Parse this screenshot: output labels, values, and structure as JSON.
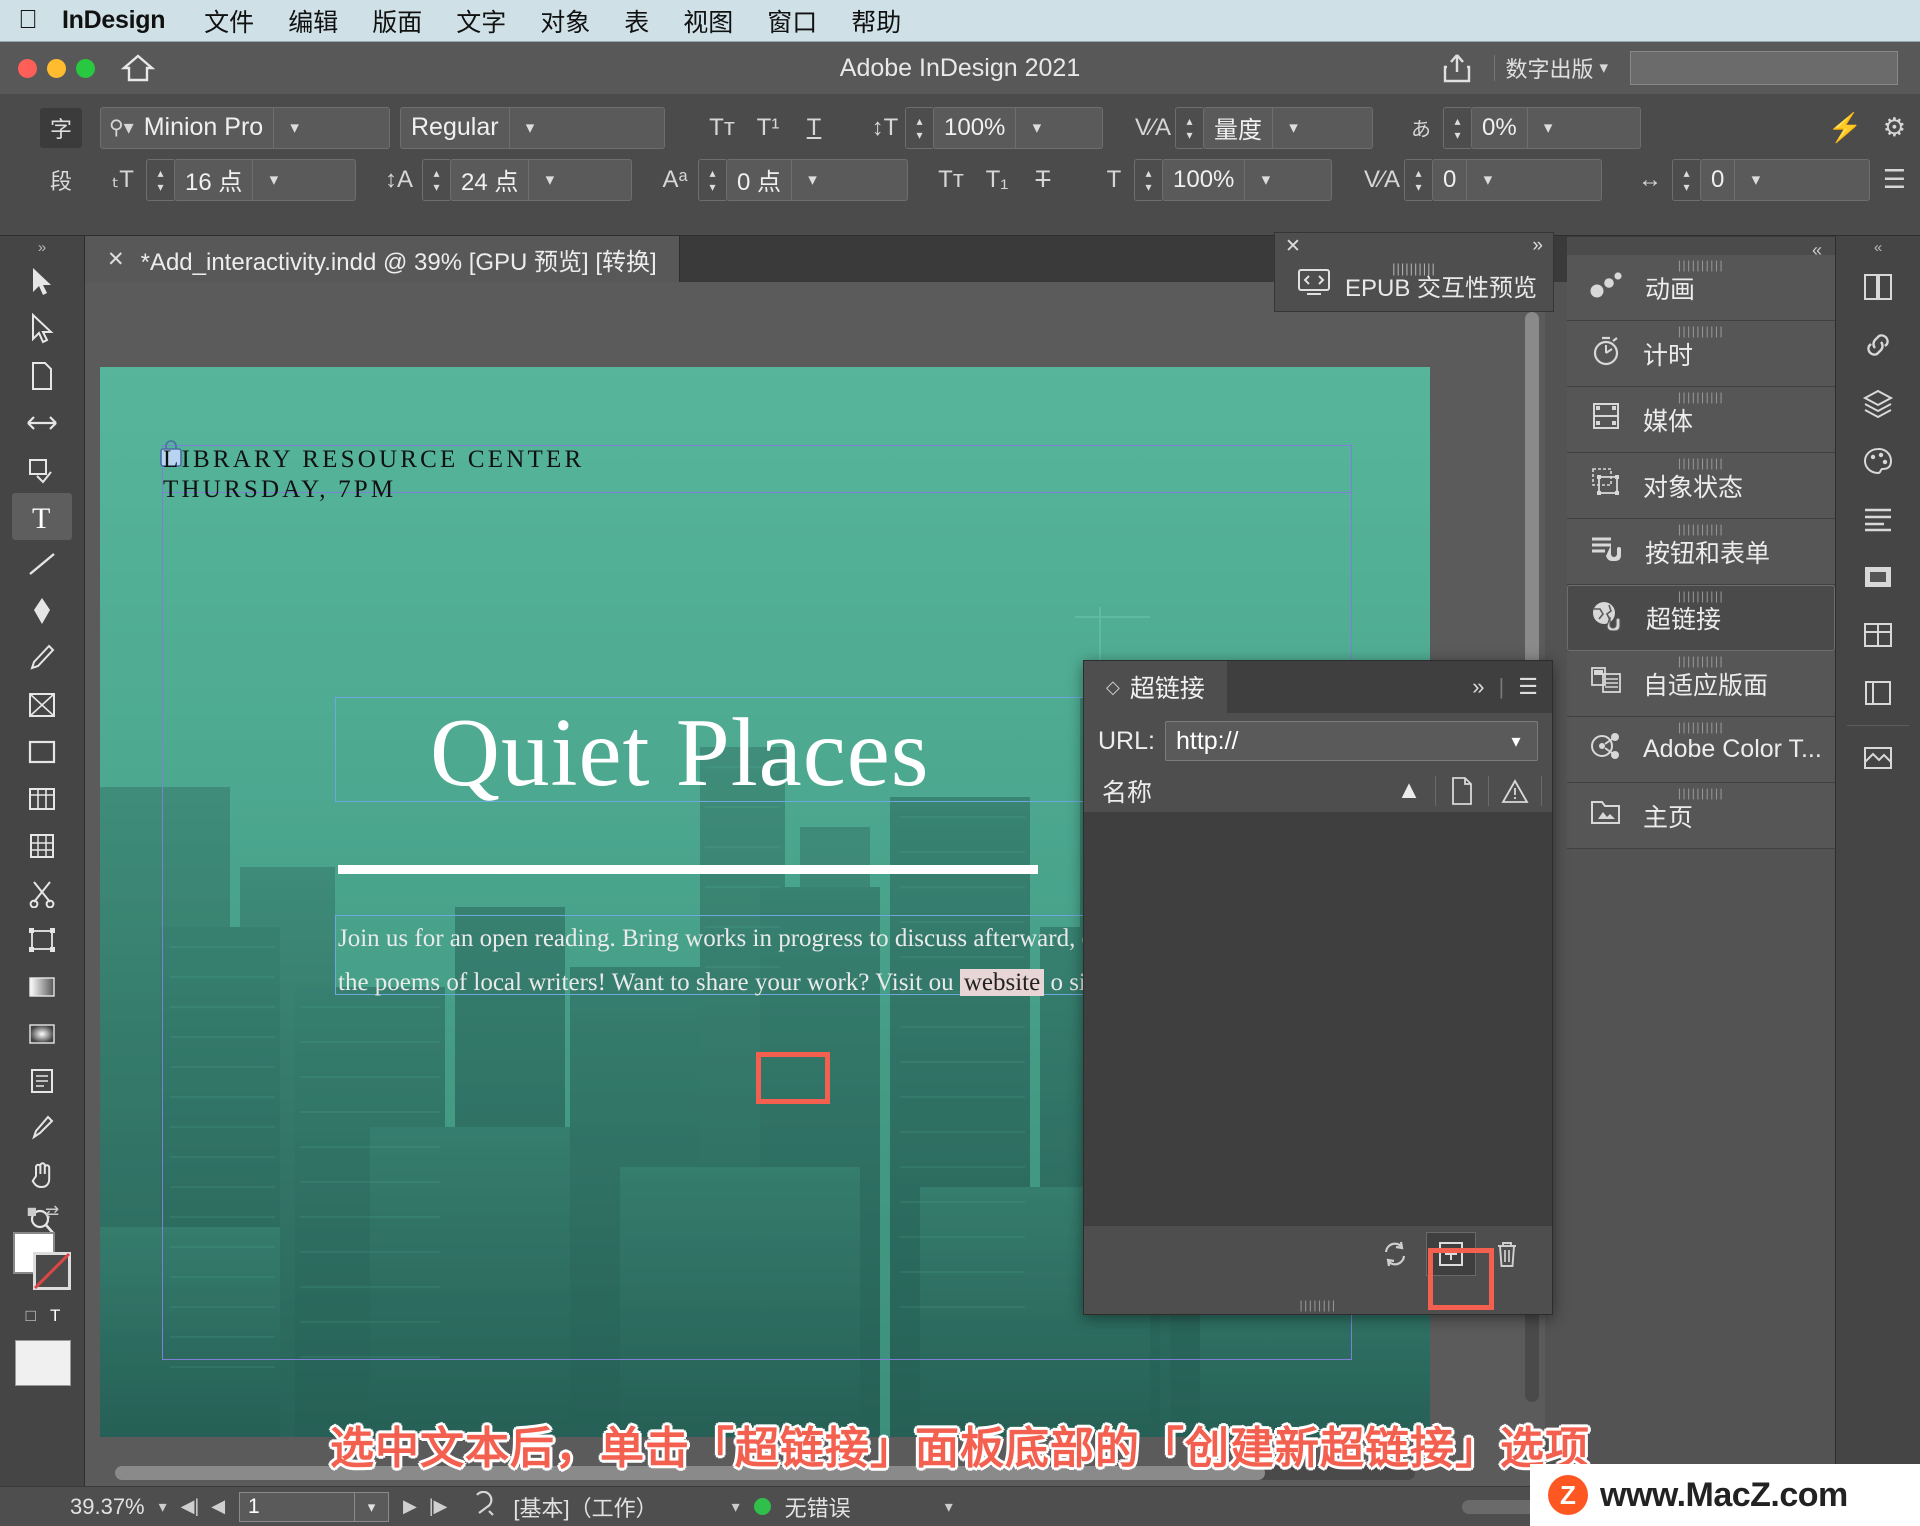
{
  "menubar": {
    "apple_icon": "apple-logo",
    "app_name": "InDesign",
    "items": [
      "文件",
      "编辑",
      "版面",
      "文字",
      "对象",
      "表",
      "视图",
      "窗口",
      "帮助"
    ]
  },
  "titlebar": {
    "title": "Adobe InDesign 2021",
    "home_icon": "home-icon",
    "share_icon": "share-icon",
    "workspace": "数字出版",
    "workspace_chevron": "chevron-down-icon",
    "search_placeholder": ""
  },
  "control_bar": {
    "char_mode_label": "字",
    "para_mode_label": "段",
    "font_family": "Minion Pro",
    "font_style": "Regular",
    "font_size": "16 点",
    "leading": "24 点",
    "baseline_shift": "0 点",
    "all_caps_icon": "all-caps-icon",
    "superscript_icon": "superscript-icon",
    "underline_icon": "underline-icon",
    "small_caps_icon": "small-caps-icon",
    "subscript_icon": "subscript-icon",
    "strikethrough_icon": "strikethrough-icon",
    "vertical_scale": "100%",
    "horizontal_scale": "100%",
    "kerning": "量度",
    "tracking": "0",
    "tsume": "0%",
    "grid_spacing": "0"
  },
  "document_tab": {
    "close_icon": "close-icon",
    "label": "*Add_interactivity.indd @ 39% [GPU 预览] [转换]"
  },
  "toolbox": {
    "tools": [
      {
        "name": "selection-tool",
        "active": false
      },
      {
        "name": "direct-selection-tool",
        "active": false
      },
      {
        "name": "page-tool",
        "active": false
      },
      {
        "name": "gap-tool",
        "active": false
      },
      {
        "name": "content-collector-tool",
        "active": false
      },
      {
        "name": "type-tool",
        "active": true
      },
      {
        "name": "line-tool",
        "active": false
      },
      {
        "name": "pen-tool",
        "active": false
      },
      {
        "name": "pencil-tool",
        "active": false
      },
      {
        "name": "frame-tool",
        "active": false
      },
      {
        "name": "rectangle-tool",
        "active": false
      },
      {
        "name": "free-transform-tool",
        "active": false
      },
      {
        "name": "column-tool",
        "active": false
      },
      {
        "name": "scissors-tool",
        "active": false
      },
      {
        "name": "transform-tool",
        "active": false
      },
      {
        "name": "gradient-swatch-tool",
        "active": false
      },
      {
        "name": "gradient-feather-tool",
        "active": false
      },
      {
        "name": "note-tool",
        "active": false
      },
      {
        "name": "eyedropper-tool",
        "active": false
      },
      {
        "name": "hand-tool",
        "active": false
      },
      {
        "name": "zoom-tool",
        "active": false
      }
    ]
  },
  "page_content": {
    "kicker_line1": "LIBRARY RESOURCE CENTER",
    "kicker_line2": "THURSDAY, 7PM",
    "headline": "Quiet Places",
    "body_line1": "Join us for an open reading. Bring works in progress to discuss afterward, or co",
    "body_line2_a": "the poems of local writers! Want to share your work? Visit ou",
    "body_link": "website",
    "body_line2_b": "o sign u"
  },
  "epub_panel": {
    "close_icon": "close-icon",
    "expand_icon": "double-chevron-right-icon",
    "label": "EPUB 交互性预览",
    "icon": "code-preview-icon"
  },
  "panels": [
    {
      "label": "动画",
      "icon": "animation-icon",
      "selected": false
    },
    {
      "label": "计时",
      "icon": "timing-icon",
      "selected": false
    },
    {
      "label": "媒体",
      "icon": "media-icon",
      "selected": false
    },
    {
      "label": "对象状态",
      "icon": "object-states-icon",
      "selected": false
    },
    {
      "label": "按钮和表单",
      "icon": "buttons-forms-icon",
      "selected": false
    },
    {
      "label": "超链接",
      "icon": "hyperlinks-icon",
      "selected": true
    },
    {
      "label": "自适应版面",
      "icon": "liquid-layout-icon",
      "selected": false
    },
    {
      "label": "Adobe Color T...",
      "icon": "adobe-color-icon",
      "selected": false
    },
    {
      "label": "主页",
      "icon": "master-pages-icon",
      "selected": false
    }
  ],
  "dock_icons": [
    "pages-panel-icon",
    "links-panel-icon",
    "layers-panel-icon",
    "color-panel-icon",
    "paragraph-styles-icon",
    "stroke-panel-icon",
    "table-panel-icon",
    "book-panel-icon",
    "effects-panel-icon"
  ],
  "hyperlinks_panel": {
    "tab_label": "超链接",
    "tab_diamond_icon": "diamond-icon",
    "expand_icon": "double-chevron-right-icon",
    "menu_icon": "hamburger-menu-icon",
    "url_label": "URL:",
    "url_value": "http://",
    "url_dropdown_icon": "chevron-down-icon",
    "name_column": "名称",
    "sort_icon": "sort-ascending-icon",
    "page_icon": "page-icon",
    "warning_icon": "warning-icon",
    "footer": {
      "refresh_icon": "refresh-icon",
      "new_hyperlink_icon": "new-hyperlink-plus-icon",
      "delete_icon": "trash-icon"
    }
  },
  "caption": "选中文本后，单击「超链接」面板底部的「创建新超链接」选项",
  "statusbar": {
    "zoom": "39.37%",
    "zoom_chevron": "chevron-down-icon",
    "first_page_icon": "first-page-icon",
    "prev_page_icon": "prev-page-icon",
    "page_number": "1",
    "page_dropdown_icon": "chevron-down-icon",
    "next_page_icon": "next-page-icon",
    "last_page_icon": "last-page-icon",
    "preflight_icon": "preflight-icon",
    "preflight_profile": "[基本]（工作）",
    "profile_chevron": "chevron-down-icon",
    "status_dot_color": "#2fbf4a",
    "status_text": "无错误",
    "status_chevron": "chevron-down-icon"
  },
  "watermark": {
    "badge": "Z",
    "url": "www.MacZ.com"
  },
  "colors": {
    "accent_red": "#f4604f",
    "menubar_bg": "#cfe0e6",
    "chrome_bg": "#4b4b4b",
    "page_teal": "#55a58f"
  }
}
